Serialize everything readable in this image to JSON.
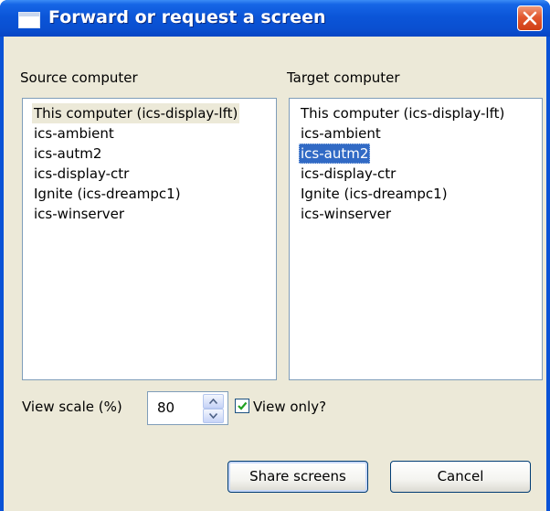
{
  "window": {
    "title": "Forward or request a screen"
  },
  "source": {
    "label": "Source computer",
    "items": [
      "This computer (ics-display-lft)",
      "ics-ambient",
      "ics-autm2",
      "ics-display-ctr",
      "Ignite (ics-dreampc1)",
      "ics-winserver"
    ],
    "current_index": 0
  },
  "target": {
    "label": "Target computer",
    "items": [
      "This computer (ics-display-lft)",
      "ics-ambient",
      "ics-autm2",
      "ics-display-ctr",
      "Ignite (ics-dreampc1)",
      "ics-winserver"
    ],
    "selected_index": 2
  },
  "view_scale": {
    "label": "View scale (%)",
    "value": "80"
  },
  "view_only": {
    "label": "View only?",
    "checked": true
  },
  "buttons": {
    "share": "Share screens",
    "cancel": "Cancel"
  },
  "colors": {
    "titlebar": "#0a4fd0",
    "selection": "#316ac5",
    "dialog_bg": "#ece9d8",
    "close": "#e2582f"
  }
}
